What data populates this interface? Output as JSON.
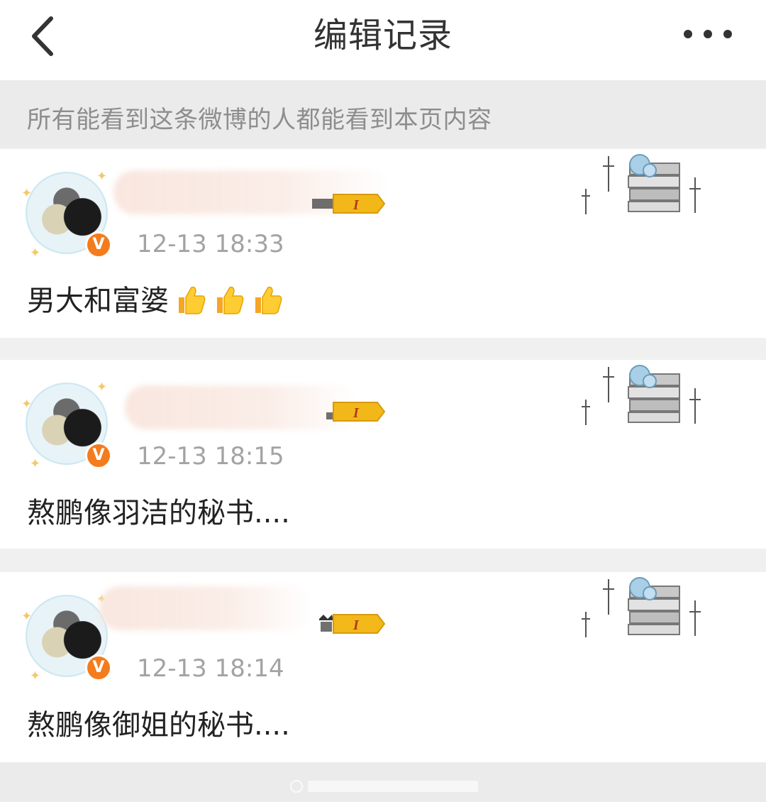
{
  "nav": {
    "title": "编辑记录",
    "back_icon": "chevron-left-icon",
    "more_icon": "more-dots-icon"
  },
  "notice": {
    "text": "所有能看到这条微博的人都能看到本页内容"
  },
  "records": [
    {
      "time": "12-13 18:33",
      "text": "男大和富婆",
      "emoji_count": 3
    },
    {
      "time": "12-13 18:15",
      "text": "熬鹏像羽洁的秘书...."
    },
    {
      "time": "12-13 18:14",
      "text": "熬鹏像御姐的秘书...."
    }
  ],
  "badge": {
    "label": "V",
    "color": "#f47c1e"
  },
  "colors": {
    "background": "#f0f0f0",
    "card": "#ffffff",
    "time_text": "#a3a3a3",
    "vip_gold": "#f2b81a"
  }
}
